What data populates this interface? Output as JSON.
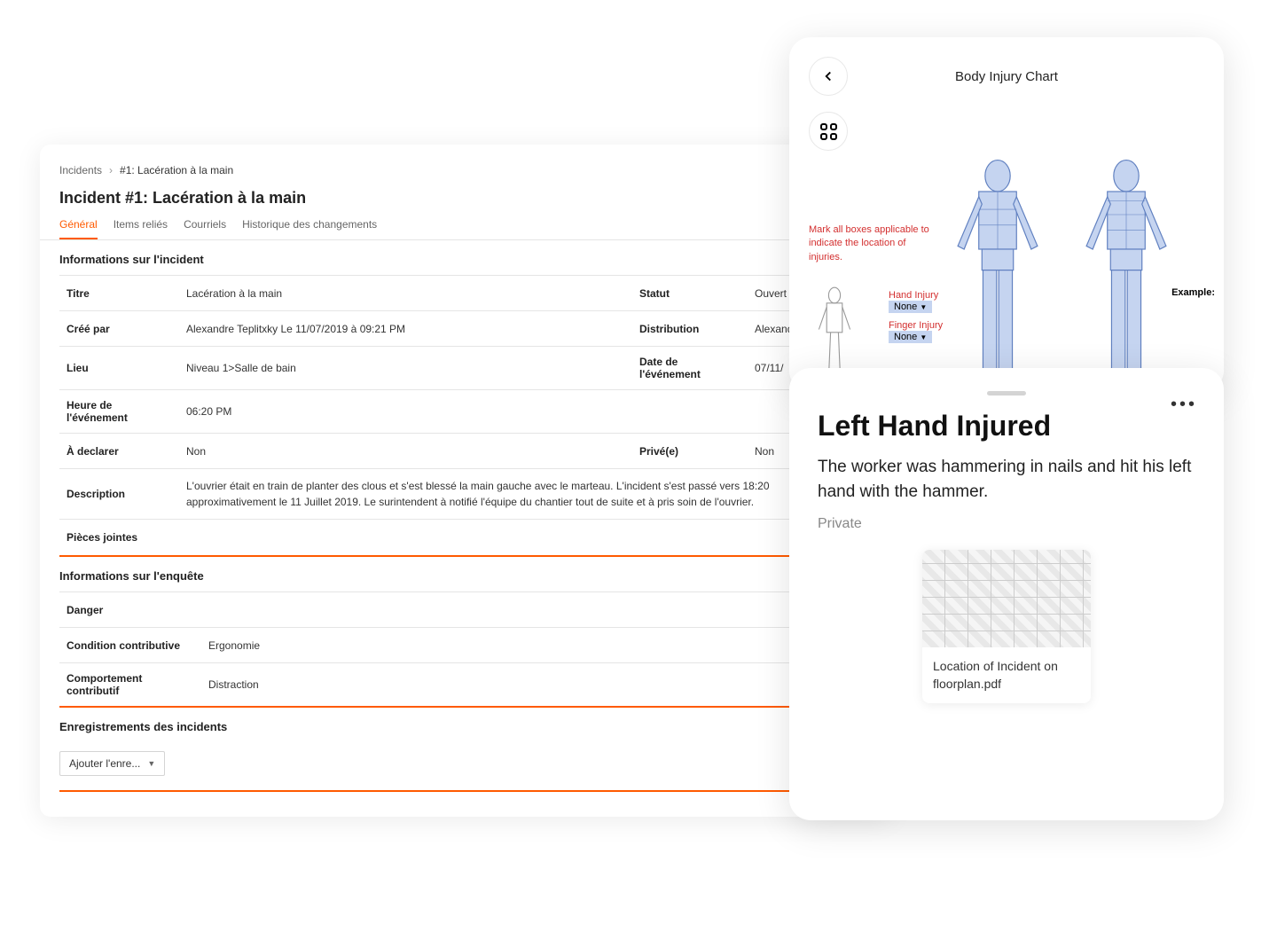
{
  "breadcrumb": {
    "root": "Incidents",
    "current": "#1: Lacération à la main"
  },
  "pageTitle": "Incident #1: Lacération à la main",
  "tabs": {
    "general": "Général",
    "items": "Items reliés",
    "emails": "Courriels",
    "history": "Historique des changements"
  },
  "sections": {
    "incidentInfo": "Informations sur l'incident",
    "investigation": "Informations sur l'enquête",
    "records": "Enregistrements des incidents"
  },
  "fields": {
    "titre": {
      "label": "Titre",
      "value": "Lacération à la main"
    },
    "statut": {
      "label": "Statut",
      "value": "Ouvert"
    },
    "creePar": {
      "label": "Créé par",
      "value": "Alexandre Teplitxky Le 11/07/2019 à 09:21 PM"
    },
    "distribution": {
      "label": "Distribution",
      "value": "Alexandre Quentin"
    },
    "lieu": {
      "label": "Lieu",
      "value": "Niveau 1>Salle de bain"
    },
    "dateEvenement": {
      "label": "Date de l'événement",
      "value": "07/11/"
    },
    "heureEvenement": {
      "label": "Heure de l'événement",
      "value": "06:20 PM"
    },
    "aDeclarer": {
      "label": "À declarer",
      "value": "Non"
    },
    "prive": {
      "label": "Privé(e)",
      "value": "Non"
    },
    "description": {
      "label": "Description",
      "value": "L'ouvrier était en train de planter des clous et s'est blessé la main gauche avec le marteau. L'incident s'est passé vers 18:20 approximativement le 11 Juillet 2019. Le surintendent à notifié l'équipe du chantier tout de suite et à pris soin de l'ouvrier."
    },
    "piecesJointes": {
      "label": "Pièces jointes"
    },
    "danger": {
      "label": "Danger"
    },
    "conditionContributive": {
      "label": "Condition contributive",
      "value": "Ergonomie"
    },
    "comportementContributif": {
      "label": "Comportement contributif",
      "value": "Distraction"
    }
  },
  "addRecordLabel": "Ajouter l'enre...",
  "bodyChart": {
    "title": "Body Injury Chart",
    "instructions": "Mark all boxes applicable to indicate the location of injuries.",
    "handInjury": {
      "label": "Hand Injury",
      "value": "None"
    },
    "fingerInjury": {
      "label": "Finger Injury",
      "value": "None"
    },
    "example": "Example:"
  },
  "detail": {
    "title": "Left Hand Injured",
    "body": "The worker was hammering in nails and hit his left hand with the hammer.",
    "status": "Private",
    "attachmentName": "Location of Incident on floorplan.pdf"
  }
}
